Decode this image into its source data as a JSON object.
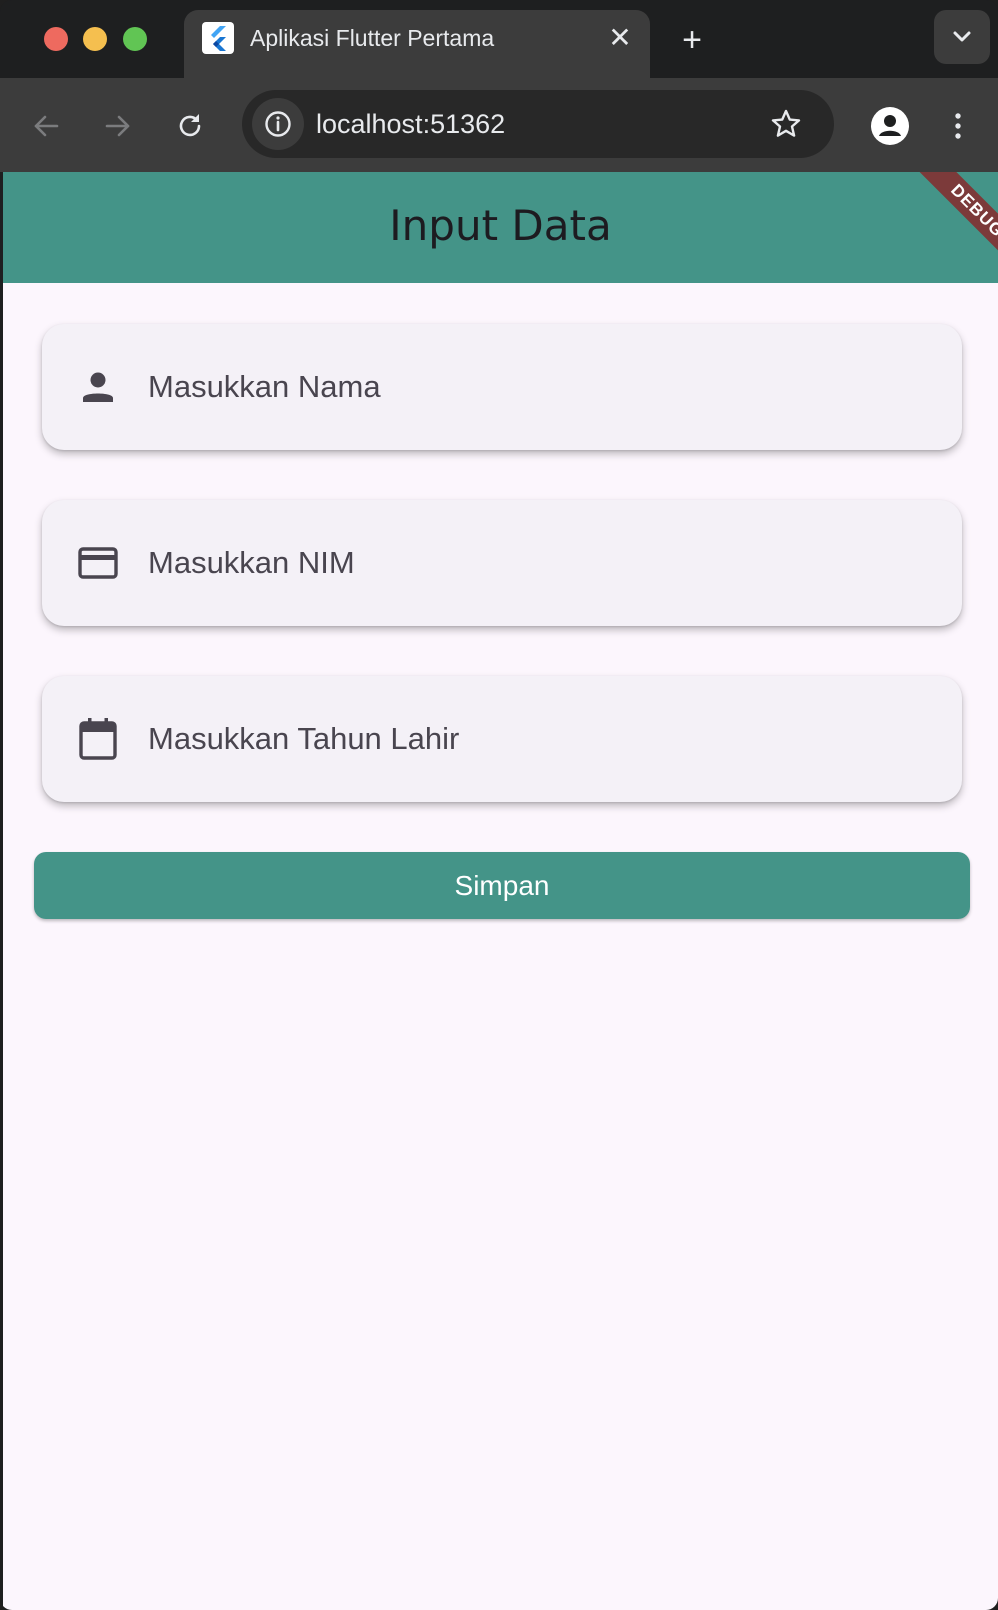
{
  "browser": {
    "tab_title": "Aplikasi Flutter Pertama",
    "tab_close_glyph": "✕",
    "new_tab_glyph": "+",
    "url": "localhost:51362",
    "icons": [
      "back-arrow-icon",
      "forward-arrow-icon",
      "reload-icon",
      "info-icon",
      "star-icon",
      "profile-icon",
      "more-vert-icon",
      "chevron-down-icon",
      "flutter-logo-icon"
    ]
  },
  "app": {
    "title": "Input Data",
    "debug_banner": "DEBUG",
    "accent_color": "#449488",
    "fields": [
      {
        "icon": "person-icon",
        "placeholder": "Masukkan Nama",
        "value": ""
      },
      {
        "icon": "credit-card-icon",
        "placeholder": "Masukkan NIM",
        "value": ""
      },
      {
        "icon": "calendar-icon",
        "placeholder": "Masukkan Tahun Lahir",
        "value": ""
      }
    ],
    "save_label": "Simpan"
  }
}
